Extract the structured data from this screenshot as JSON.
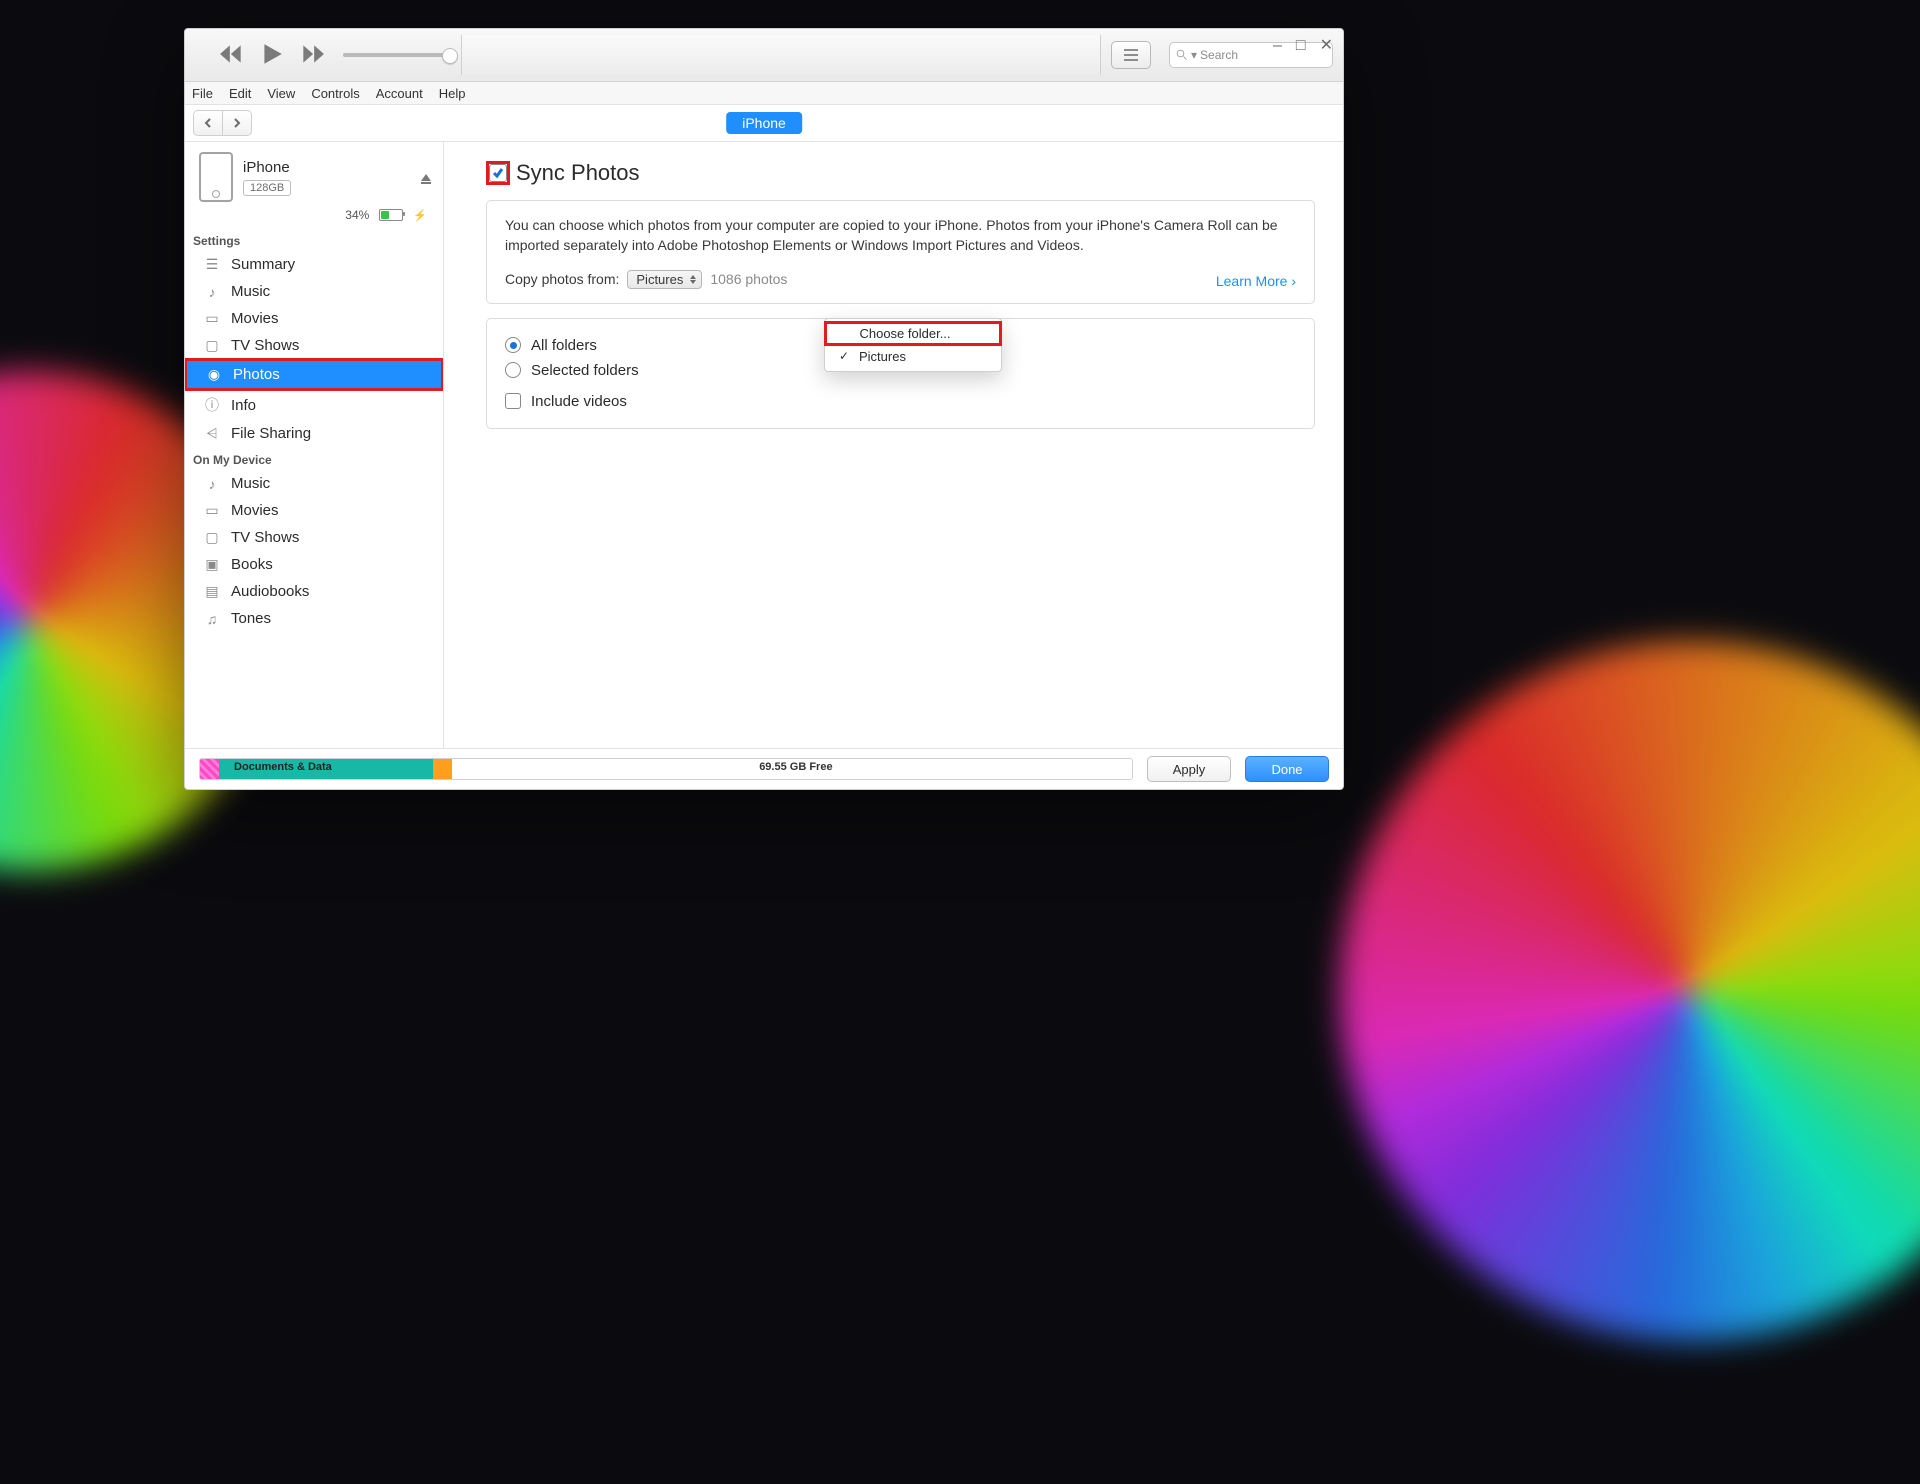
{
  "window_controls": {
    "minimize": "–",
    "maximize": "□",
    "close": "✕"
  },
  "menubar": [
    "File",
    "Edit",
    "View",
    "Controls",
    "Account",
    "Help"
  ],
  "search": {
    "placeholder": "Search",
    "glyph": "Q▾"
  },
  "device_chip": "iPhone",
  "device": {
    "name": "iPhone",
    "capacity": "128GB",
    "battery_pct": "34%"
  },
  "sidebar": {
    "section_settings": "Settings",
    "settings": [
      {
        "icon": "☰",
        "label": "Summary"
      },
      {
        "icon": "♪",
        "label": "Music"
      },
      {
        "icon": "▭",
        "label": "Movies"
      },
      {
        "icon": "▢",
        "label": "TV Shows"
      },
      {
        "icon": "◉",
        "label": "Photos",
        "selected": true
      },
      {
        "icon": "ⓘ",
        "label": "Info"
      },
      {
        "icon": "⩤",
        "label": "File Sharing"
      }
    ],
    "section_device": "On My Device",
    "device_items": [
      {
        "icon": "♪",
        "label": "Music"
      },
      {
        "icon": "▭",
        "label": "Movies"
      },
      {
        "icon": "▢",
        "label": "TV Shows"
      },
      {
        "icon": "▣",
        "label": "Books"
      },
      {
        "icon": "▤",
        "label": "Audiobooks"
      },
      {
        "icon": "♫",
        "label": "Tones"
      }
    ]
  },
  "main": {
    "sync_title": "Sync Photos",
    "description": "You can choose which photos from your computer are copied to your iPhone. Photos from your iPhone's Camera Roll can be imported separately into Adobe Photoshop Elements or Windows Import Pictures and Videos.",
    "copy_label": "Copy photos from:",
    "copy_source": "Pictures",
    "photo_count": "1086 photos",
    "learn_more": "Learn More",
    "dd_choose": "Choose folder...",
    "dd_pictures": "Pictures",
    "opt_all": "All folders",
    "opt_selected": "Selected folders",
    "opt_videos": "Include videos"
  },
  "footer": {
    "docs_label": "Documents & Data",
    "free_label": "69.55 GB Free",
    "apply": "Apply",
    "done": "Done"
  }
}
